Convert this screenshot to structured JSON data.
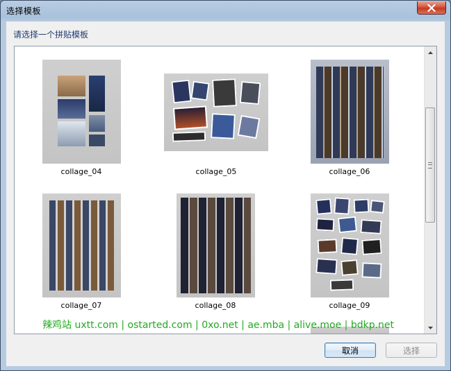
{
  "window": {
    "title": "选择模板"
  },
  "dialog": {
    "prompt": "请选择一个拼贴模板"
  },
  "templates": [
    {
      "name": "collage_04"
    },
    {
      "name": "collage_05"
    },
    {
      "name": "collage_06"
    },
    {
      "name": "collage_07"
    },
    {
      "name": "collage_08"
    },
    {
      "name": "collage_09"
    }
  ],
  "watermark": "辣鸡站 uxtt.com | ostarted.com | 0xo.net | ae.mba | alive.moe | bdkp.net",
  "buttons": {
    "cancel": "取消",
    "select": "选择"
  },
  "icons": {
    "close": "close-icon",
    "scroll_up": "scroll-up-arrow-icon",
    "scroll_down": "scroll-down-arrow-icon"
  },
  "colors": {
    "accent": "#1f3a6e",
    "watermark": "#22aa22",
    "close_button": "#c63a1e"
  }
}
